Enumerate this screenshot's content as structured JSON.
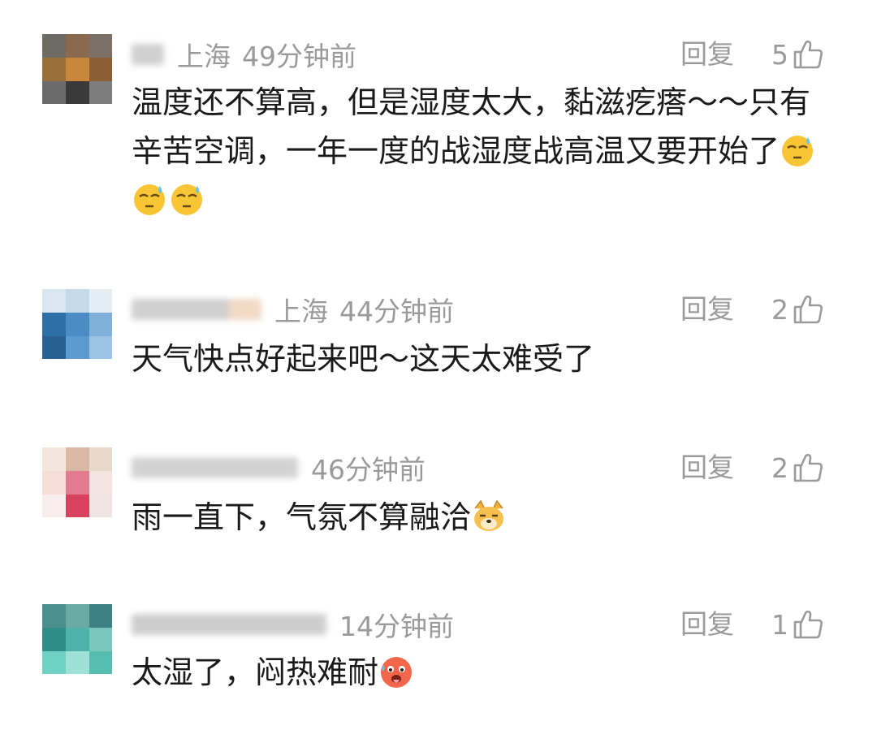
{
  "reply_label": "回复",
  "comments": [
    {
      "location": "上海",
      "time": "49分钟前",
      "likes": "5",
      "text": "温度还不算高，但是湿度太大，黏滋疙瘩～～只有辛苦空调，一年一度的战湿度战高温又要开始了",
      "emojis": [
        "sweat-smile-emoji",
        "sweat-smile-emoji",
        "sweat-smile-emoji"
      ],
      "avatar_colors": [
        "#6e6a66",
        "#8a6a4e",
        "#7a7068",
        "#9a6f3c",
        "#c9853c",
        "#8a5e32",
        "#6b6b6b",
        "#3a3a3a",
        "#7d7d7d"
      ]
    },
    {
      "location": "上海",
      "time": "44分钟前",
      "likes": "2",
      "text": "天气快点好起来吧～这天太难受了",
      "emojis": [],
      "avatar_colors": [
        "#d9e6f0",
        "#c5d9ea",
        "#e4edf4",
        "#2f6fa8",
        "#4b8cc4",
        "#7fb0da",
        "#2a5f92",
        "#5c9bd0",
        "#9cc3e4"
      ]
    },
    {
      "location": "",
      "time": "46分钟前",
      "likes": "2",
      "text": "雨一直下，气氛不算融洽",
      "emojis": [
        "doge-emoji"
      ],
      "avatar_colors": [
        "#f3e7dc",
        "#d9b9a6",
        "#e8d8ca",
        "#f5dcd4",
        "#e27b8e",
        "#f2e4e0",
        "#f7ecec",
        "#d8425e",
        "#efe3e3"
      ]
    },
    {
      "location": "",
      "time": "14分钟前",
      "likes": "1",
      "text": "太湿了，闷热难耐",
      "emojis": [
        "hot-face-emoji"
      ],
      "avatar_colors": [
        "#4c8f8f",
        "#6aa9a4",
        "#3f7f86",
        "#2f8e8a",
        "#4fb3ab",
        "#7bc7bd",
        "#6fd0c4",
        "#9fe1d6",
        "#57bdb1"
      ]
    }
  ]
}
